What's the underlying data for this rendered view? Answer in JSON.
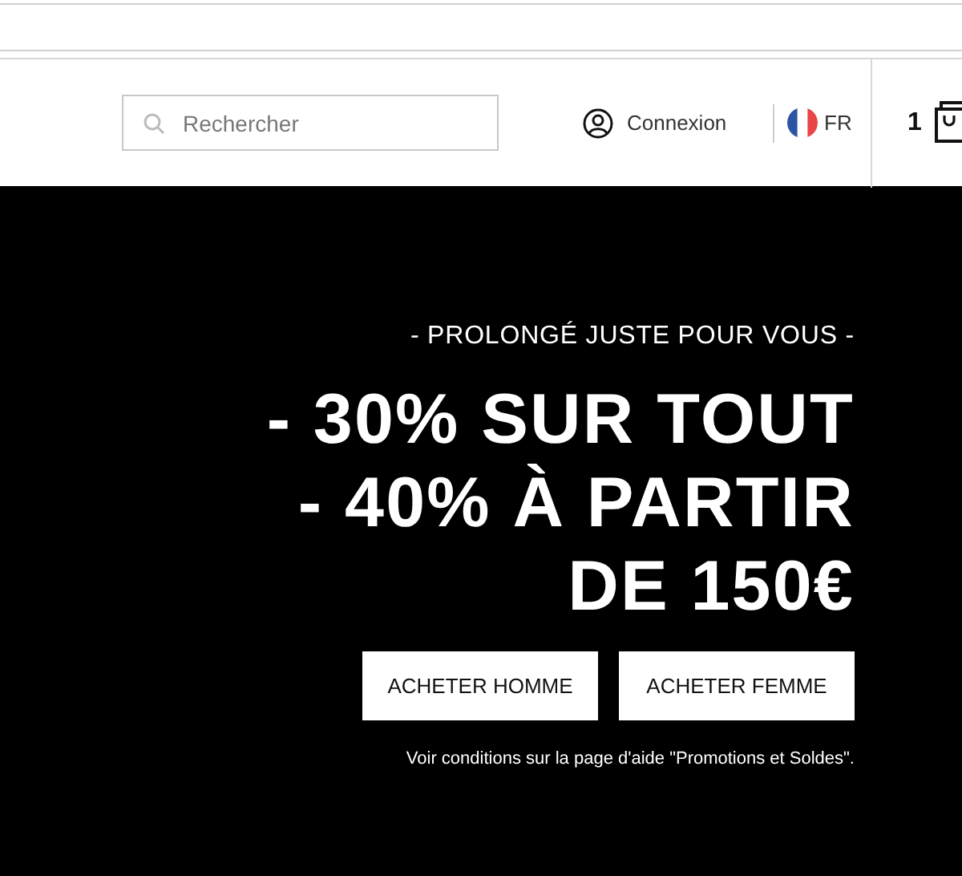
{
  "header": {
    "search": {
      "placeholder": "Rechercher"
    },
    "login": "Connexion",
    "language": "FR",
    "cart_count": "1"
  },
  "banner": {
    "tagline": "- PROLONGÉ JUSTE POUR VOUS -",
    "headline": [
      "- 30% SUR TOUT",
      "- 40% À PARTIR",
      "DE 150€"
    ],
    "buttons": [
      "ACHETER HOMME",
      "ACHETER FEMME"
    ],
    "note": "Voir conditions sur la page d'aide \"Promotions et Soldes\"."
  }
}
